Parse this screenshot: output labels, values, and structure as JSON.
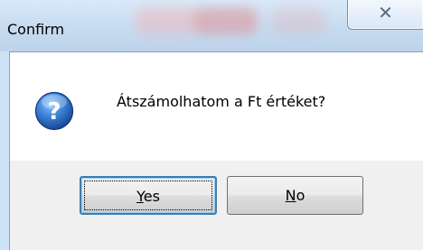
{
  "window": {
    "title": "Confirm",
    "close_glyph": "✕"
  },
  "dialog": {
    "icon": "question-icon",
    "message": "Átszámolhatom a Ft értéket?"
  },
  "buttons": {
    "yes": {
      "mnemonic": "Y",
      "rest": "es"
    },
    "no": {
      "mnemonic": "N",
      "rest": "o"
    }
  },
  "colors": {
    "titlebar": "#c7dbf0",
    "icon_blue": "#1f5fb8",
    "default_button_border": "#3c7fb1"
  }
}
